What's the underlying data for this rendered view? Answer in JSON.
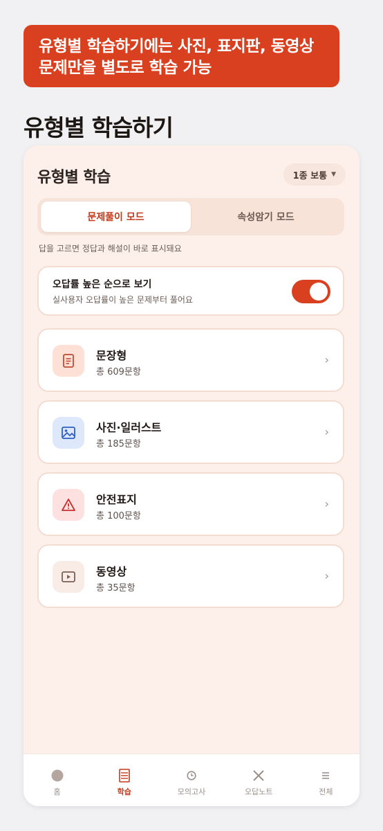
{
  "promo": {
    "line1": "유형별 학습하기에는 사진, 표지판, 동영상",
    "line2": "문제만을 별도로 학습 가능"
  },
  "page_title": "유형별 학습하기",
  "app": {
    "header_title": "유형별 학습",
    "level_select": "1종 보통"
  },
  "modes": {
    "tabs": [
      "문제풀이 모드",
      "속성암기 모드"
    ],
    "active": 0,
    "description": "답을 고르면 정답과 해설이 바로 표시돼요"
  },
  "wrong_rate_toggle": {
    "title": "오답률 높은 순으로 보기",
    "subtitle": "실사용자 오답률이 높은 문제부터 풀어요",
    "on": true
  },
  "categories": [
    {
      "name": "문장형",
      "count": "총 609문항",
      "icon": "document-icon",
      "color": "#c24a33"
    },
    {
      "name": "사진·일러스트",
      "count": "총 185문항",
      "icon": "image-icon",
      "color": "#2d5fc4"
    },
    {
      "name": "안전표지",
      "count": "총 100문항",
      "icon": "warning-icon",
      "color": "#c62f2f"
    },
    {
      "name": "동영상",
      "count": "총 35문항",
      "icon": "play-icon",
      "color": "#7a5f55"
    }
  ],
  "bottom_nav": [
    {
      "label": "홈",
      "icon": "home-icon"
    },
    {
      "label": "학습",
      "icon": "study-icon"
    },
    {
      "label": "모의고사",
      "icon": "clock-icon"
    },
    {
      "label": "오답노트",
      "icon": "x-icon"
    },
    {
      "label": "전체",
      "icon": "menu-icon"
    }
  ],
  "colors": {
    "accent": "#d9401f",
    "accent_text": "#c4391b"
  }
}
